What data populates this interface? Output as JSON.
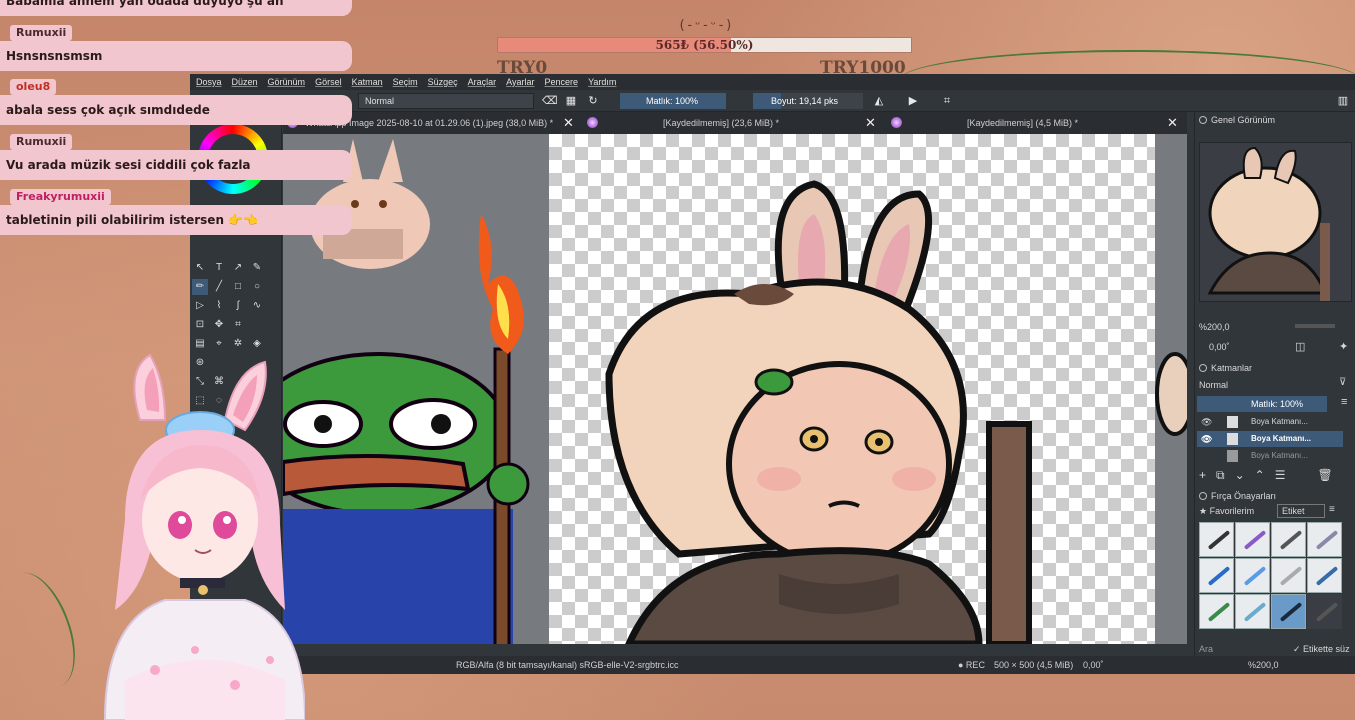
{
  "goal": {
    "face": "(-ᵕ-ᵕ-)",
    "text": "565₺ (56.50%)",
    "progress_fraction": 0.565,
    "min_label": "TRY0",
    "max_label": "TRY1000"
  },
  "chat": [
    {
      "user": "",
      "message": "Babamla annem yan odada duyuyo şu an"
    },
    {
      "user": "Rumuxii",
      "message": "Hsnsnsnsmsm"
    },
    {
      "user": "oleu8",
      "message": "abala sess çok açık sımdıdede"
    },
    {
      "user": "Rumuxii",
      "message": "Vu arada müzik sesi ciddili çok fazla"
    },
    {
      "user": "Freakyrumuxii",
      "message": "tabletinin pili olabilirim istersen 👉👈"
    }
  ],
  "menu": [
    "Dosya",
    "Düzen",
    "Görünüm",
    "Görsel",
    "Katman",
    "Seçim",
    "Süzgeç",
    "Araçlar",
    "Ayarlar",
    "Pencere",
    "Yardım"
  ],
  "toolbar": {
    "blend_mode": "Normal",
    "opacity": "Matlık: 100%",
    "size": "Boyut: 19,14 pks"
  },
  "tabs": [
    {
      "label": "WhatsApp Image 2025-08-10 at 01.29.06 (1).jpeg (38,0 MiB) *"
    },
    {
      "label": "[Kaydedilmemiş]  (23,6 MiB) *"
    },
    {
      "label": "[Kaydedilmemiş]  (4,5 MiB) *"
    }
  ],
  "status": {
    "color_info": "RGB/Alfa (8 bit tamsayı/kanal)  sRGB-elle-V2-srgbtrc.icc",
    "rec": "● REC",
    "dimensions": "500 × 500 (4,5 MiB)",
    "rotation": "0,00˚",
    "zoom": "%200,0"
  },
  "dockers": {
    "overview_title": "Genel Görünüm",
    "overview_zoom": "%200,0",
    "overview_rotation": "0,00˚",
    "layers_title": "Katmanlar",
    "layers_blend": "Normal",
    "layers_opacity": "Matlık:  100%",
    "layers": [
      {
        "name": "Boya Katmanı...",
        "selected": false
      },
      {
        "name": "Boya Katmanı...",
        "selected": true
      },
      {
        "name": "Boya Katmanı...",
        "selected": false
      }
    ],
    "brush_title": "Fırça Önayarları",
    "brush_favorites": "Favorilerim",
    "brush_tag": "Etiket",
    "brush_search": "Ara",
    "brush_filter": "Etikette süz"
  },
  "colors": {
    "accent": "#3d5a78",
    "panel": "#31363b",
    "chat_bubble": "#f2c6cf",
    "goal_fill": "#e88a7a"
  }
}
